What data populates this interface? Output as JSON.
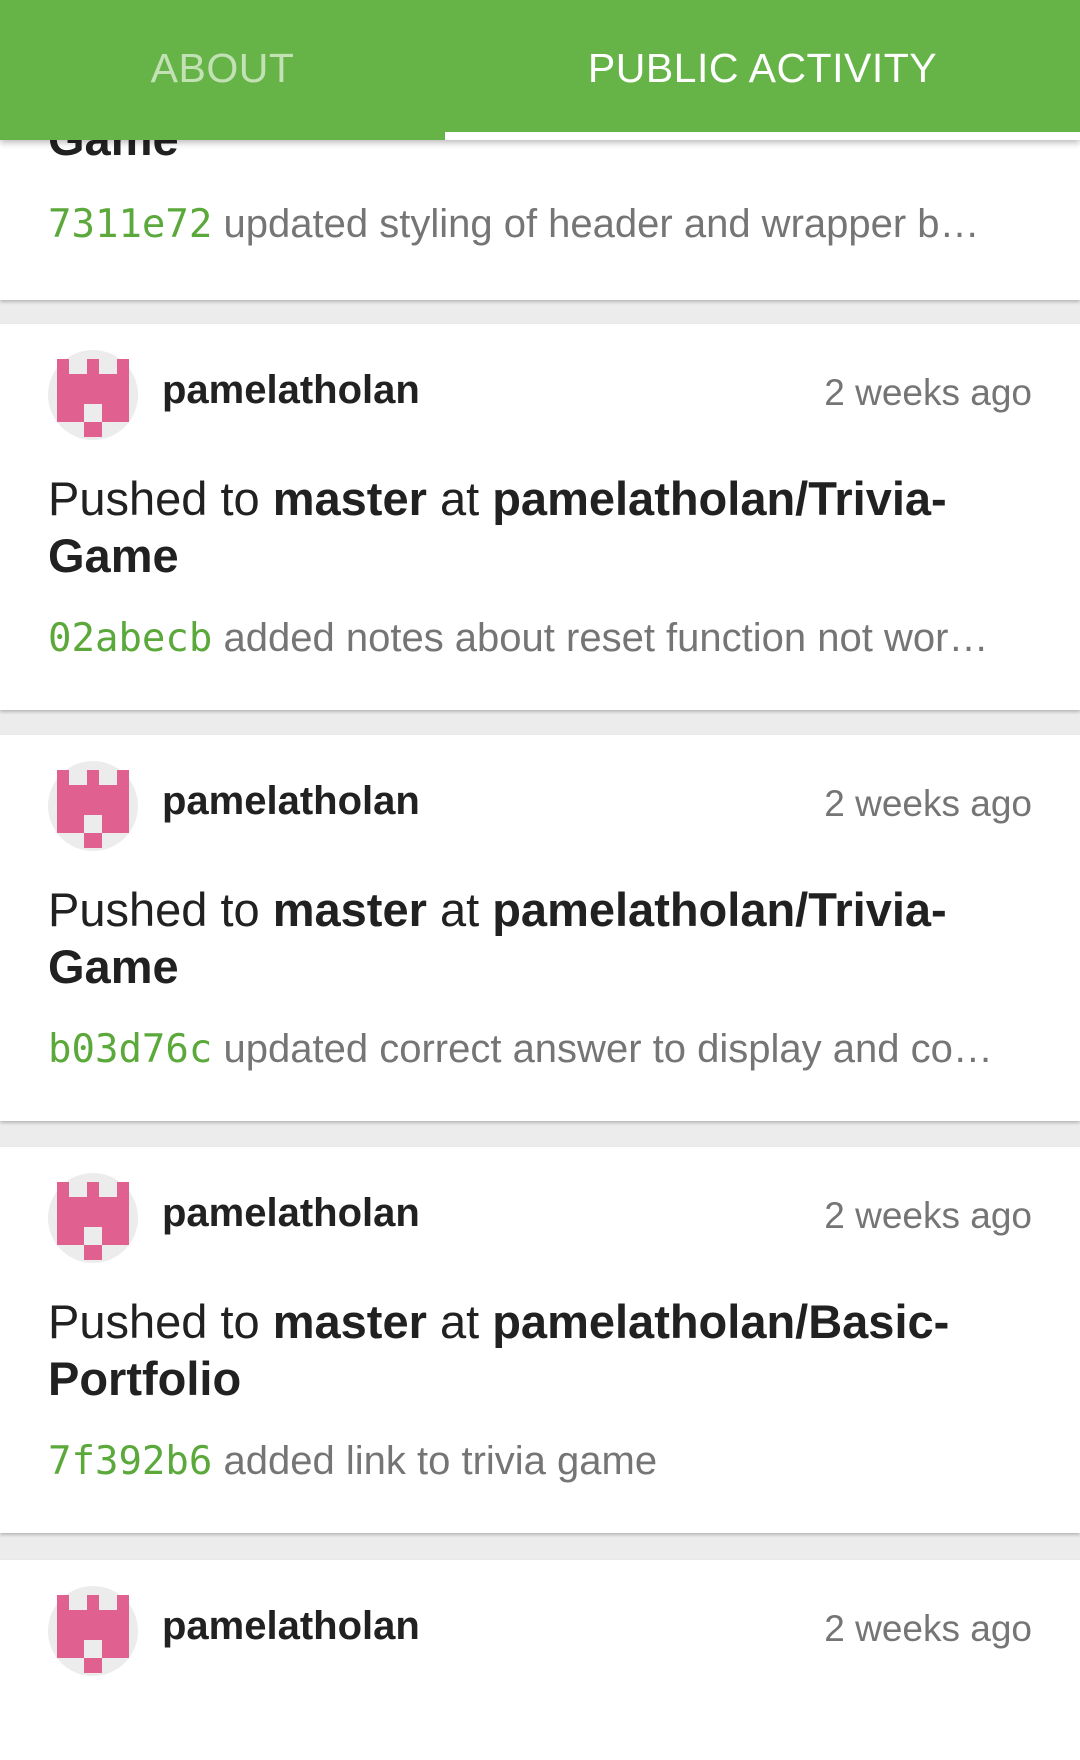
{
  "tabs": {
    "about": "ABOUT",
    "public_activity": "PUBLIC ACTIVITY"
  },
  "colors": {
    "tabbar": "#66b447",
    "commit_sha": "#5ba83b",
    "avatar_pink": "#e0608f"
  },
  "partial_event": {
    "repo_tail": "Game",
    "commit": {
      "sha": "7311e72",
      "message": "updated styling of header and wrapper b…"
    }
  },
  "events": [
    {
      "user": "pamelatholan",
      "time": "2 weeks ago",
      "verb": "Pushed to",
      "branch": "master",
      "at": "at",
      "repo": "pamelatholan/Trivia-Game",
      "commit": {
        "sha": "02abecb",
        "message": "added notes about reset function not wor…"
      }
    },
    {
      "user": "pamelatholan",
      "time": "2 weeks ago",
      "verb": "Pushed to",
      "branch": "master",
      "at": "at",
      "repo": "pamelatholan/Trivia-Game",
      "commit": {
        "sha": "b03d76c",
        "message": "updated correct answer to display and co…"
      }
    },
    {
      "user": "pamelatholan",
      "time": "2 weeks ago",
      "verb": "Pushed to",
      "branch": "master",
      "at": "at",
      "repo": "pamelatholan/Basic-Portfolio",
      "commit": {
        "sha": "7f392b6",
        "message": "added link to trivia game"
      }
    },
    {
      "user": "pamelatholan",
      "time": "2 weeks ago"
    }
  ]
}
